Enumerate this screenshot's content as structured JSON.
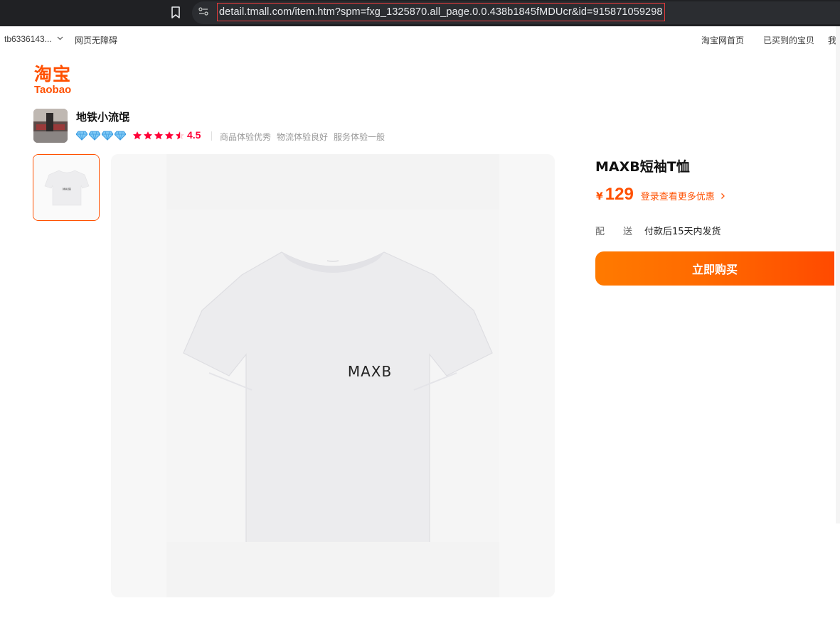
{
  "browser": {
    "url": "detail.tmall.com/item.htm?spm=fxg_1325870.all_page.0.0.438b1845fMDUcr&id=915871059298"
  },
  "site_top": {
    "user": "tb6336143...",
    "accessibility": "网页无障碍",
    "nav": [
      "淘宝网首页",
      "已买到的宝贝",
      "我"
    ]
  },
  "logo": {
    "cn": "淘宝",
    "en": "Taobao"
  },
  "shop": {
    "name": "地铁小流氓",
    "diamonds": 4,
    "rating": "4.5",
    "metrics": [
      "商品体验优秀",
      "物流体验良好",
      "服务体验一般"
    ]
  },
  "product": {
    "title": "MAXB短袖T恤",
    "currency": "¥",
    "price": "129",
    "login_promo": "登录查看更多优惠",
    "shipping_label": "配送",
    "shipping_value": "付款后15天内发货",
    "buy_label": "立即购买",
    "print_text": "MAXB"
  },
  "colors": {
    "accent": "#ff5000",
    "rating_red": "#ff0036",
    "browser_bg": "#202124"
  }
}
